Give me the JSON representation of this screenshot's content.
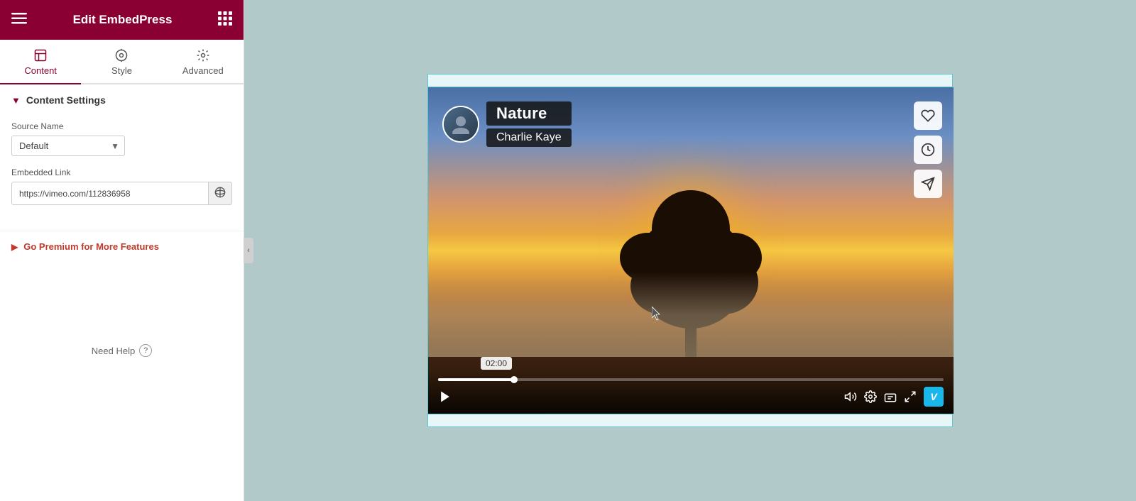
{
  "header": {
    "title": "Edit EmbedPress",
    "menu_icon": "≡",
    "grid_icon": "⋮⋮⋮"
  },
  "tabs": [
    {
      "id": "content",
      "label": "Content",
      "active": true
    },
    {
      "id": "style",
      "label": "Style",
      "active": false
    },
    {
      "id": "advanced",
      "label": "Advanced",
      "active": false
    }
  ],
  "content_settings": {
    "section_title": "Content Settings",
    "source_name_label": "Source Name",
    "source_name_value": "Default",
    "embedded_link_label": "Embedded Link",
    "embedded_link_value": "https://vimeo.com/112836958",
    "embedded_link_placeholder": "https://vimeo.com/112836958"
  },
  "premium": {
    "label": "Go Premium for More Features"
  },
  "help": {
    "label": "Need Help"
  },
  "video": {
    "title": "Nature",
    "author": "Charlie Kaye",
    "timestamp": "02:00"
  },
  "colors": {
    "brand": "#8b0032",
    "accent": "#5bc8d8",
    "premium_red": "#c0392b"
  }
}
